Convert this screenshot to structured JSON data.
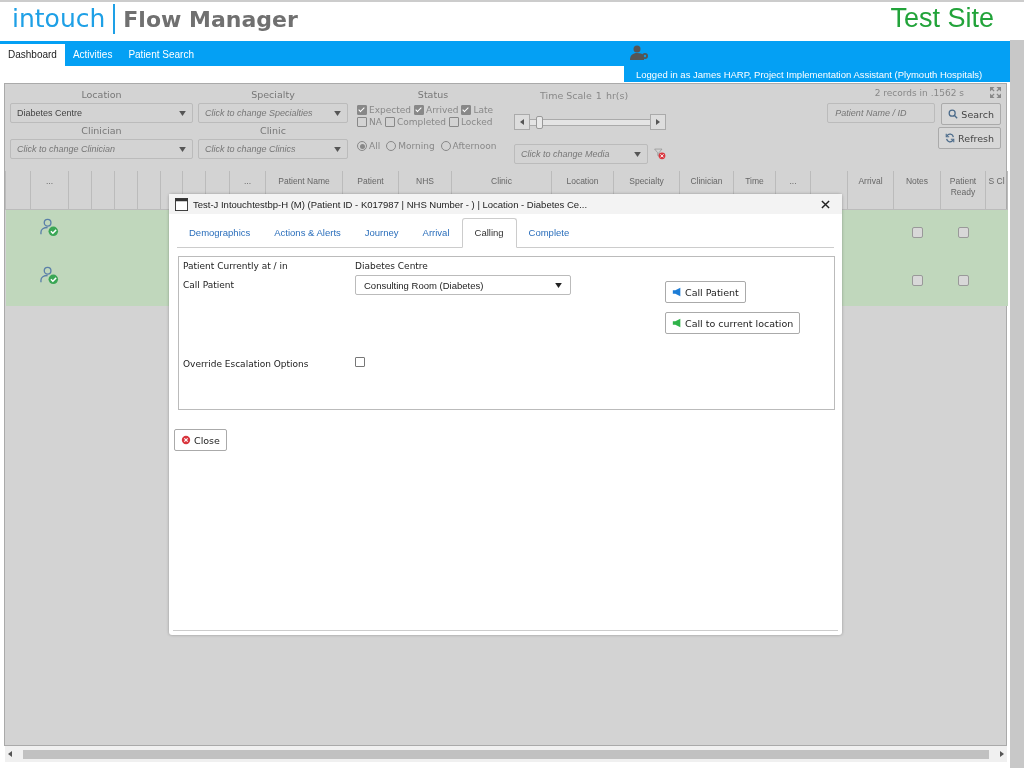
{
  "header": {
    "logo": "intouch",
    "app_name": "Flow Manager",
    "site": "Test Site"
  },
  "nav": {
    "tabs": [
      {
        "label": "Dashboard",
        "selected": true
      },
      {
        "label": "Activities",
        "selected": false
      },
      {
        "label": "Patient Search",
        "selected": false
      }
    ],
    "user": "Logged in as James HARP, Project Implementation Assistant (Plymouth Hospitals)"
  },
  "filters": {
    "location": {
      "label": "Location",
      "value": "Diabetes Centre"
    },
    "specialty": {
      "label": "Specialty",
      "placeholder": "Click to change Specialties"
    },
    "clinician": {
      "label": "Clinician",
      "placeholder": "Click to change Clinician"
    },
    "clinic": {
      "label": "Clinic",
      "placeholder": "Click to change Clinics"
    },
    "status": {
      "label": "Status",
      "options": [
        {
          "label": "Expected",
          "checked": true
        },
        {
          "label": "Arrived",
          "checked": true
        },
        {
          "label": "Late",
          "checked": true
        },
        {
          "label": "NA",
          "checked": false
        },
        {
          "label": "Completed",
          "checked": false
        },
        {
          "label": "Locked",
          "checked": false
        }
      ]
    },
    "session": [
      {
        "label": "All",
        "selected": true
      },
      {
        "label": "Morning",
        "selected": false
      },
      {
        "label": "Afternoon",
        "selected": false
      }
    ],
    "time_scale": {
      "label": "Time Scale",
      "value": "1",
      "unit": "hr(s)",
      "level": 0.05
    },
    "media": {
      "placeholder": "Click to change Media"
    },
    "records": "2 records in .1562 s",
    "search": {
      "placeholder": "Patient Name / ID",
      "button": "Search"
    },
    "refresh": "Refresh"
  },
  "table": {
    "columns": [
      "",
      "...",
      "",
      "",
      "",
      "",
      "",
      "",
      "",
      "...",
      "Patient Name",
      "Patient",
      "NHS",
      "Clinic",
      "Location",
      "Specialty",
      "Clinician",
      "Time",
      "...",
      "",
      "Arrival",
      "Notes",
      "Patient Ready",
      "S Cl"
    ],
    "rows": [
      {
        "notes": false,
        "patient_ready": false
      },
      {
        "notes": false,
        "patient_ready": false
      }
    ]
  },
  "modal": {
    "title": "Test-J Intouchtestbp-H (M) (Patient ID - K017987 | NHS Number - ) | Location - Diabetes Ce...",
    "tabs": [
      {
        "label": "Demographics",
        "selected": false
      },
      {
        "label": "Actions & Alerts",
        "selected": false
      },
      {
        "label": "Journey",
        "selected": false
      },
      {
        "label": "Arrival",
        "selected": false
      },
      {
        "label": "Calling",
        "selected": true
      },
      {
        "label": "Complete",
        "selected": false
      }
    ],
    "current_label": "Patient Currently at / in",
    "current_value": "Diabetes Centre",
    "call_label": "Call Patient",
    "call_select": "Consulting Room (Diabetes)",
    "call_button": "Call Patient",
    "call_current_button": "Call to current location",
    "override_label": "Override Escalation Options",
    "override_checked": false,
    "close": "Close"
  }
}
